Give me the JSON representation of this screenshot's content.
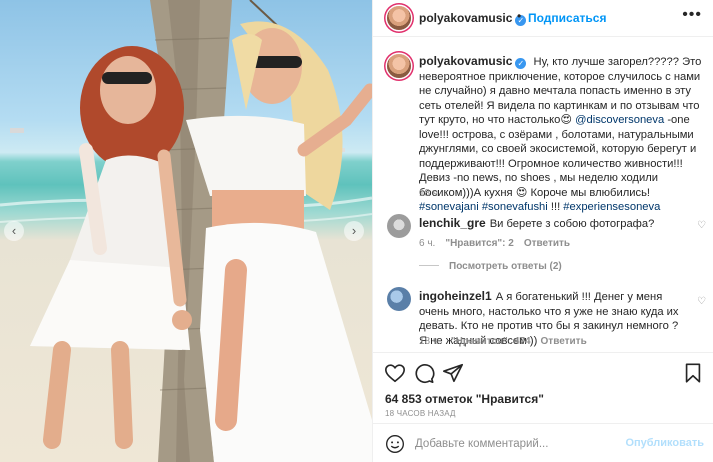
{
  "header": {
    "username": "polyakovamusic",
    "follow_label": "Подписаться",
    "separator": "•",
    "more_label": "•••"
  },
  "caption": {
    "username": "polyakovamusic",
    "text_1": "Ну, кто лучше загорел????? Это невероятное приключение, которое случилось с нами не случайно) я давно мечтала попасть именно в эту сеть отелей! Я видела по картинкам и по отзывам что тут круто, но что настолько",
    "emoji_1": "😍",
    "mention": "@discoversoneva",
    "text_2": " -one love!!! острова, с озёрами , болотами, натуральными джунглями, со своей экосистемой, которую берегут и поддерживают!!! Огромное количество живности!!! Девиз -no news, no shoes , мы неделю ходили босиком)))А кухня ",
    "emoji_2": "😍",
    "text_3": " Короче мы влюбились! ",
    "hashtags_1": "#sonevajani #sonevafushi",
    "text_4": " !!! ",
    "hashtags_2": "#experiensesoneva",
    "time": "18 ч."
  },
  "comments": [
    {
      "username": "lenchik_gre",
      "text": "Ви берете з собою фотографа?",
      "time": "6 ч.",
      "likes": "\"Нравится\": 2",
      "reply": "Ответить"
    },
    {
      "username": "ingoheinzel1",
      "text": "А я богатенький !!! Денег у меня очень много, настолько что я уже не знаю куда их девать. Кто не против что бы я закинул немного ? Я не жадный совсем ))",
      "time": "18 ч.",
      "likes": "\"Нравится\": 474",
      "reply": "Ответить"
    }
  ],
  "view_replies": "Посмотреть ответы (2)",
  "likes_text": "64 853 отметок \"Нравится\"",
  "post_time": "18 ЧАСОВ НАЗАД",
  "add_comment": {
    "placeholder": "Добавьте комментарий...",
    "publish_label": "Опубликовать"
  },
  "icons": {
    "like": "heart-icon",
    "comment": "comment-icon",
    "share": "paper-plane-icon",
    "save": "bookmark-icon",
    "emoji": "smiley-icon",
    "prev": "chevron-left-icon",
    "next": "chevron-right-icon"
  },
  "colors": {
    "accent": "#0095f6",
    "muted": "#8e8e8e",
    "text": "#262626",
    "verified": "#3897f0"
  }
}
